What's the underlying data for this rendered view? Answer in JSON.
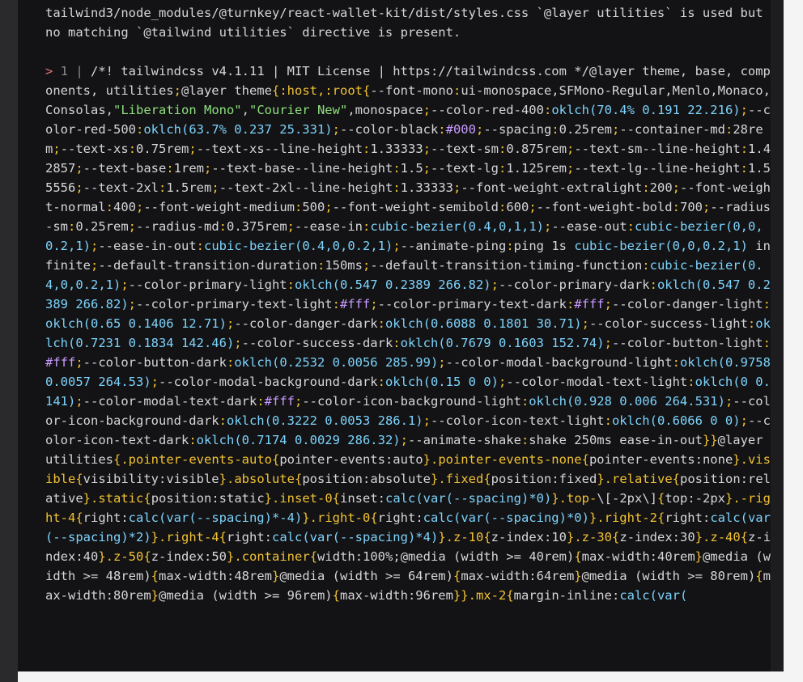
{
  "overlay": {
    "error_message": "tailwind3/node_modules/@turnkey/react-wallet-kit/dist/styles.css `@layer utilities` is used but no matching `@tailwind utilities` directive is present.",
    "pointer": "> ",
    "line_number": "1",
    "separator": " | ",
    "tokens": [
      [
        "cmt",
        "/*! tailwindcss v4.1.11 | MIT License | https://tailwindcss.com */"
      ],
      [
        "at",
        "@layer"
      ],
      [
        "text",
        " theme, base, components, utilities"
      ],
      [
        "punc",
        ";"
      ],
      [
        "at",
        "@layer"
      ],
      [
        "text",
        " theme"
      ],
      [
        "punc",
        "{"
      ],
      [
        "sel",
        ":host,:root"
      ],
      [
        "punc",
        "{"
      ],
      [
        "prop",
        "--font-mono"
      ],
      [
        "punc",
        ":"
      ],
      [
        "val",
        "ui-monospace,SFMono-Regular,Menlo,Monaco,Consolas,"
      ],
      [
        "str",
        "\"Liberation Mono\""
      ],
      [
        "val",
        ","
      ],
      [
        "str",
        "\"Courier New\""
      ],
      [
        "val",
        ",monospace"
      ],
      [
        "punc",
        ";"
      ],
      [
        "prop",
        "--color-red-400"
      ],
      [
        "punc",
        ":"
      ],
      [
        "fn",
        "oklch(70.4% 0.191 22.216)"
      ],
      [
        "punc",
        ";"
      ],
      [
        "prop",
        "--color-red-500"
      ],
      [
        "punc",
        ":"
      ],
      [
        "fn",
        "oklch(63.7% 0.237 25.331)"
      ],
      [
        "punc",
        ";"
      ],
      [
        "prop",
        "--color-black"
      ],
      [
        "punc",
        ":"
      ],
      [
        "hex",
        "#000"
      ],
      [
        "punc",
        ";"
      ],
      [
        "prop",
        "--spacing"
      ],
      [
        "punc",
        ":"
      ],
      [
        "val",
        "0.25rem"
      ],
      [
        "punc",
        ";"
      ],
      [
        "prop",
        "--container-md"
      ],
      [
        "punc",
        ":"
      ],
      [
        "val",
        "28rem"
      ],
      [
        "punc",
        ";"
      ],
      [
        "prop",
        "--text-xs"
      ],
      [
        "punc",
        ":"
      ],
      [
        "val",
        "0.75rem"
      ],
      [
        "punc",
        ";"
      ],
      [
        "prop",
        "--text-xs--line-height"
      ],
      [
        "punc",
        ":"
      ],
      [
        "val",
        "1.33333"
      ],
      [
        "punc",
        ";"
      ],
      [
        "prop",
        "--text-sm"
      ],
      [
        "punc",
        ":"
      ],
      [
        "val",
        "0.875rem"
      ],
      [
        "punc",
        ";"
      ],
      [
        "prop",
        "--text-sm--line-height"
      ],
      [
        "punc",
        ":"
      ],
      [
        "val",
        "1.42857"
      ],
      [
        "punc",
        ";"
      ],
      [
        "prop",
        "--text-base"
      ],
      [
        "punc",
        ":"
      ],
      [
        "val",
        "1rem"
      ],
      [
        "punc",
        ";"
      ],
      [
        "prop",
        "--text-base--line-height"
      ],
      [
        "punc",
        ":"
      ],
      [
        "val",
        "1.5"
      ],
      [
        "punc",
        ";"
      ],
      [
        "prop",
        "--text-lg"
      ],
      [
        "punc",
        ":"
      ],
      [
        "val",
        "1.125rem"
      ],
      [
        "punc",
        ";"
      ],
      [
        "prop",
        "--text-lg--line-height"
      ],
      [
        "punc",
        ":"
      ],
      [
        "val",
        "1.55556"
      ],
      [
        "punc",
        ";"
      ],
      [
        "prop",
        "--text-2xl"
      ],
      [
        "punc",
        ":"
      ],
      [
        "val",
        "1.5rem"
      ],
      [
        "punc",
        ";"
      ],
      [
        "prop",
        "--text-2xl--line-height"
      ],
      [
        "punc",
        ":"
      ],
      [
        "val",
        "1.33333"
      ],
      [
        "punc",
        ";"
      ],
      [
        "prop",
        "--font-weight-extralight"
      ],
      [
        "punc",
        ":"
      ],
      [
        "val",
        "200"
      ],
      [
        "punc",
        ";"
      ],
      [
        "prop",
        "--font-weight-normal"
      ],
      [
        "punc",
        ":"
      ],
      [
        "val",
        "400"
      ],
      [
        "punc",
        ";"
      ],
      [
        "prop",
        "--font-weight-medium"
      ],
      [
        "punc",
        ":"
      ],
      [
        "val",
        "500"
      ],
      [
        "punc",
        ";"
      ],
      [
        "prop",
        "--font-weight-semibold"
      ],
      [
        "punc",
        ":"
      ],
      [
        "val",
        "600"
      ],
      [
        "punc",
        ";"
      ],
      [
        "prop",
        "--font-weight-bold"
      ],
      [
        "punc",
        ":"
      ],
      [
        "val",
        "700"
      ],
      [
        "punc",
        ";"
      ],
      [
        "prop",
        "--radius-sm"
      ],
      [
        "punc",
        ":"
      ],
      [
        "val",
        "0.25rem"
      ],
      [
        "punc",
        ";"
      ],
      [
        "prop",
        "--radius-md"
      ],
      [
        "punc",
        ":"
      ],
      [
        "val",
        "0.375rem"
      ],
      [
        "punc",
        ";"
      ],
      [
        "prop",
        "--ease-in"
      ],
      [
        "punc",
        ":"
      ],
      [
        "fn",
        "cubic-bezier(0.4,0,1,1)"
      ],
      [
        "punc",
        ";"
      ],
      [
        "prop",
        "--ease-out"
      ],
      [
        "punc",
        ":"
      ],
      [
        "fn",
        "cubic-bezier(0,0,0.2,1)"
      ],
      [
        "punc",
        ";"
      ],
      [
        "prop",
        "--ease-in-out"
      ],
      [
        "punc",
        ":"
      ],
      [
        "fn",
        "cubic-bezier(0.4,0,0.2,1)"
      ],
      [
        "punc",
        ";"
      ],
      [
        "prop",
        "--animate-ping"
      ],
      [
        "punc",
        ":"
      ],
      [
        "val",
        "ping 1s "
      ],
      [
        "fn",
        "cubic-bezier(0,0,0.2,1)"
      ],
      [
        "val",
        " infinite"
      ],
      [
        "punc",
        ";"
      ],
      [
        "prop",
        "--default-transition-duration"
      ],
      [
        "punc",
        ":"
      ],
      [
        "val",
        "150ms"
      ],
      [
        "punc",
        ";"
      ],
      [
        "prop",
        "--default-transition-timing-function"
      ],
      [
        "punc",
        ":"
      ],
      [
        "fn",
        "cubic-bezier(0.4,0,0.2,1)"
      ],
      [
        "punc",
        ";"
      ],
      [
        "prop",
        "--color-primary-light"
      ],
      [
        "punc",
        ":"
      ],
      [
        "fn",
        "oklch(0.547 0.2389 266.82)"
      ],
      [
        "punc",
        ";"
      ],
      [
        "prop",
        "--color-primary-dark"
      ],
      [
        "punc",
        ":"
      ],
      [
        "fn",
        "oklch(0.547 0.2389 266.82)"
      ],
      [
        "punc",
        ";"
      ],
      [
        "prop",
        "--color-primary-text-light"
      ],
      [
        "punc",
        ":"
      ],
      [
        "hex",
        "#fff"
      ],
      [
        "punc",
        ";"
      ],
      [
        "prop",
        "--color-primary-text-dark"
      ],
      [
        "punc",
        ":"
      ],
      [
        "hex",
        "#fff"
      ],
      [
        "punc",
        ";"
      ],
      [
        "prop",
        "--color-danger-light"
      ],
      [
        "punc",
        ":"
      ],
      [
        "fn",
        "oklch(0.65 0.1406 12.71)"
      ],
      [
        "punc",
        ";"
      ],
      [
        "prop",
        "--color-danger-dark"
      ],
      [
        "punc",
        ":"
      ],
      [
        "fn",
        "oklch(0.6088 0.1801 30.71)"
      ],
      [
        "punc",
        ";"
      ],
      [
        "prop",
        "--color-success-light"
      ],
      [
        "punc",
        ":"
      ],
      [
        "fn",
        "oklch(0.7231 0.1834 142.46)"
      ],
      [
        "punc",
        ";"
      ],
      [
        "prop",
        "--color-success-dark"
      ],
      [
        "punc",
        ":"
      ],
      [
        "fn",
        "oklch(0.7679 0.1603 152.74)"
      ],
      [
        "punc",
        ";"
      ],
      [
        "prop",
        "--color-button-light"
      ],
      [
        "punc",
        ":"
      ],
      [
        "hex",
        "#fff"
      ],
      [
        "punc",
        ";"
      ],
      [
        "prop",
        "--color-button-dark"
      ],
      [
        "punc",
        ":"
      ],
      [
        "fn",
        "oklch(0.2532 0.0056 285.99)"
      ],
      [
        "punc",
        ";"
      ],
      [
        "prop",
        "--color-modal-background-light"
      ],
      [
        "punc",
        ":"
      ],
      [
        "fn",
        "oklch(0.9758 0.0057 264.53)"
      ],
      [
        "punc",
        ";"
      ],
      [
        "prop",
        "--color-modal-background-dark"
      ],
      [
        "punc",
        ":"
      ],
      [
        "fn",
        "oklch(0.15 0 0)"
      ],
      [
        "punc",
        ";"
      ],
      [
        "prop",
        "--color-modal-text-light"
      ],
      [
        "punc",
        ":"
      ],
      [
        "fn",
        "oklch(0 0.141)"
      ],
      [
        "punc",
        ";"
      ],
      [
        "prop",
        "--color-modal-text-dark"
      ],
      [
        "punc",
        ":"
      ],
      [
        "hex",
        "#fff"
      ],
      [
        "punc",
        ";"
      ],
      [
        "prop",
        "--color-icon-background-light"
      ],
      [
        "punc",
        ":"
      ],
      [
        "fn",
        "oklch(0.928 0.006 264.531)"
      ],
      [
        "punc",
        ";"
      ],
      [
        "prop",
        "--color-icon-background-dark"
      ],
      [
        "punc",
        ":"
      ],
      [
        "fn",
        "oklch(0.3222 0.0053 286.1)"
      ],
      [
        "punc",
        ";"
      ],
      [
        "prop",
        "--color-icon-text-light"
      ],
      [
        "punc",
        ":"
      ],
      [
        "fn",
        "oklch(0.6066 0 0)"
      ],
      [
        "punc",
        ";"
      ],
      [
        "prop",
        "--color-icon-text-dark"
      ],
      [
        "punc",
        ":"
      ],
      [
        "fn",
        "oklch(0.7174 0.0029 286.32)"
      ],
      [
        "punc",
        ";"
      ],
      [
        "prop",
        "--animate-shake"
      ],
      [
        "punc",
        ":"
      ],
      [
        "val",
        "shake 250ms ease-in-out"
      ],
      [
        "punc",
        "}}"
      ],
      [
        "at",
        "@layer"
      ],
      [
        "text",
        " utilities"
      ],
      [
        "punc",
        "{"
      ],
      [
        "sel",
        ".pointer-events-auto"
      ],
      [
        "punc",
        "{"
      ],
      [
        "prop",
        "pointer-events:auto"
      ],
      [
        "punc",
        "}"
      ],
      [
        "sel",
        ".pointer-events-none"
      ],
      [
        "punc",
        "{"
      ],
      [
        "prop",
        "pointer-events:none"
      ],
      [
        "punc",
        "}"
      ],
      [
        "sel",
        ".visible"
      ],
      [
        "punc",
        "{"
      ],
      [
        "prop",
        "visibility:visible"
      ],
      [
        "punc",
        "}"
      ],
      [
        "sel",
        ".absolute"
      ],
      [
        "punc",
        "{"
      ],
      [
        "prop",
        "position:absolute"
      ],
      [
        "punc",
        "}"
      ],
      [
        "sel",
        ".fixed"
      ],
      [
        "punc",
        "{"
      ],
      [
        "prop",
        "position:fixed"
      ],
      [
        "punc",
        "}"
      ],
      [
        "sel",
        ".relative"
      ],
      [
        "punc",
        "{"
      ],
      [
        "prop",
        "position:relative"
      ],
      [
        "punc",
        "}"
      ],
      [
        "sel",
        ".static"
      ],
      [
        "punc",
        "{"
      ],
      [
        "prop",
        "position:static"
      ],
      [
        "punc",
        "}"
      ],
      [
        "sel",
        ".inset-0"
      ],
      [
        "punc",
        "{"
      ],
      [
        "prop",
        "inset:"
      ],
      [
        "fn",
        "calc(var(--spacing)*0)"
      ],
      [
        "punc",
        "}"
      ],
      [
        "sel",
        ".top-"
      ],
      [
        "prop",
        "\\[-2px\\]"
      ],
      [
        "punc",
        "{"
      ],
      [
        "prop",
        "top:-2px"
      ],
      [
        "punc",
        "}"
      ],
      [
        "sel",
        ".-right-4"
      ],
      [
        "punc",
        "{"
      ],
      [
        "prop",
        "right:"
      ],
      [
        "fn",
        "calc(var(--spacing)*-4)"
      ],
      [
        "punc",
        "}"
      ],
      [
        "sel",
        ".right-0"
      ],
      [
        "punc",
        "{"
      ],
      [
        "prop",
        "right:"
      ],
      [
        "fn",
        "calc(var(--spacing)*0)"
      ],
      [
        "punc",
        "}"
      ],
      [
        "sel",
        ".right-2"
      ],
      [
        "punc",
        "{"
      ],
      [
        "prop",
        "right:"
      ],
      [
        "fn",
        "calc(var(--spacing)*2)"
      ],
      [
        "punc",
        "}"
      ],
      [
        "sel",
        ".right-4"
      ],
      [
        "punc",
        "{"
      ],
      [
        "prop",
        "right:"
      ],
      [
        "fn",
        "calc(var(--spacing)*4)"
      ],
      [
        "punc",
        "}"
      ],
      [
        "sel",
        ".z-10"
      ],
      [
        "punc",
        "{"
      ],
      [
        "prop",
        "z-index:10"
      ],
      [
        "punc",
        "}"
      ],
      [
        "sel",
        ".z-30"
      ],
      [
        "punc",
        "{"
      ],
      [
        "prop",
        "z-index:30"
      ],
      [
        "punc",
        "}"
      ],
      [
        "sel",
        ".z-40"
      ],
      [
        "punc",
        "{"
      ],
      [
        "prop",
        "z-index:40"
      ],
      [
        "punc",
        "}"
      ],
      [
        "sel",
        ".z-50"
      ],
      [
        "punc",
        "{"
      ],
      [
        "prop",
        "z-index:50"
      ],
      [
        "punc",
        "}"
      ],
      [
        "sel",
        ".container"
      ],
      [
        "punc",
        "{"
      ],
      [
        "prop",
        "width:100%;"
      ],
      [
        "at",
        "@media"
      ],
      [
        "text",
        " (width >= 40rem)"
      ],
      [
        "punc",
        "{"
      ],
      [
        "prop",
        "max-width:40rem"
      ],
      [
        "punc",
        "}"
      ],
      [
        "at",
        "@media"
      ],
      [
        "text",
        " (width >= 48rem)"
      ],
      [
        "punc",
        "{"
      ],
      [
        "prop",
        "max-width:48rem"
      ],
      [
        "punc",
        "}"
      ],
      [
        "at",
        "@media"
      ],
      [
        "text",
        " (width >= 64rem)"
      ],
      [
        "punc",
        "{"
      ],
      [
        "prop",
        "max-width:64rem"
      ],
      [
        "punc",
        "}"
      ],
      [
        "at",
        "@media"
      ],
      [
        "text",
        " (width >= 80rem)"
      ],
      [
        "punc",
        "{"
      ],
      [
        "prop",
        "max-width:80rem"
      ],
      [
        "punc",
        "}"
      ],
      [
        "at",
        "@media"
      ],
      [
        "text",
        " (width >= 96rem)"
      ],
      [
        "punc",
        "{"
      ],
      [
        "prop",
        "max-width:96rem"
      ],
      [
        "punc",
        "}}"
      ],
      [
        "sel",
        ".mx-2"
      ],
      [
        "punc",
        "{"
      ],
      [
        "prop",
        "margin-inline:"
      ],
      [
        "fn",
        "calc(var("
      ]
    ]
  },
  "colors": {
    "panel": "#131315",
    "text": "#d6d6d9",
    "selector": "#f2c233",
    "function": "#7dd3fc",
    "string": "#8ee07d",
    "hex": "#c89cff",
    "pointer": "#e57373",
    "comment": "#8b8b8e"
  }
}
